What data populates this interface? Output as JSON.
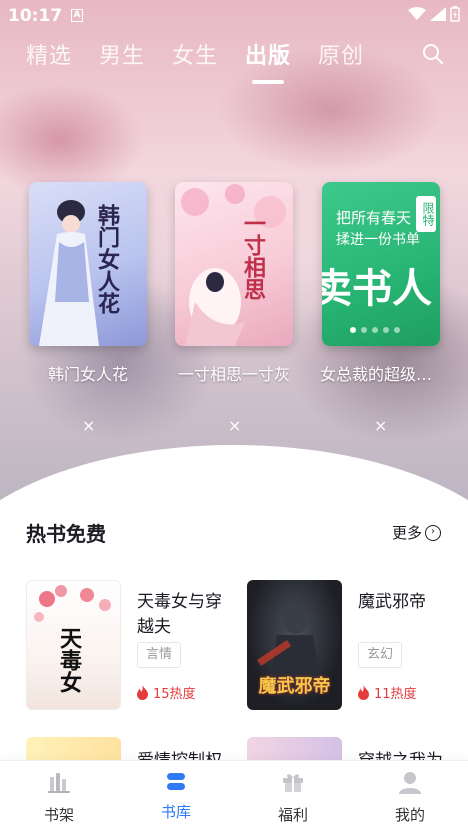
{
  "status_bar": {
    "time": "10:17",
    "notification_badge": "A"
  },
  "tabs": [
    {
      "label": "精选",
      "active": false
    },
    {
      "label": "男生",
      "active": false
    },
    {
      "label": "女生",
      "active": false
    },
    {
      "label": "出版",
      "active": true
    },
    {
      "label": "原创",
      "active": false
    }
  ],
  "carousel": {
    "books": [
      {
        "caption": "韩门女人花",
        "cover_text": "韩门女人花"
      },
      {
        "caption": "一寸相思一寸灰",
        "cover_text": "一寸相思"
      },
      {
        "caption": "女总裁的超级保镖",
        "cover_text_1": "把所有春天",
        "cover_text_2": "揉进一份书单",
        "cover_text_big": "卖书人",
        "badge": "限特"
      }
    ],
    "close_symbol": "×"
  },
  "section": {
    "title": "热书免费",
    "more_label": "更多",
    "items": [
      {
        "title": "天毒女与穿越夫",
        "tag": "言情",
        "heat": "15热度",
        "cover_text": "天毒女"
      },
      {
        "title": "魔武邪帝",
        "tag": "玄幻",
        "heat": "11热度",
        "cover_text": "魔武邪帝"
      }
    ],
    "peek_items": [
      {
        "title": "爱情控制权"
      },
      {
        "title": "穿越之我为"
      }
    ]
  },
  "bottom_nav": [
    {
      "label": "书架",
      "icon": "bookshelf-icon",
      "active": false
    },
    {
      "label": "书库",
      "icon": "library-icon",
      "active": true
    },
    {
      "label": "福利",
      "icon": "gift-icon",
      "active": false
    },
    {
      "label": "我的",
      "icon": "profile-icon",
      "active": false
    }
  ],
  "colors": {
    "accent": "#2f7bf5",
    "heat": "#e43b3b",
    "text": "#1c1c24"
  }
}
